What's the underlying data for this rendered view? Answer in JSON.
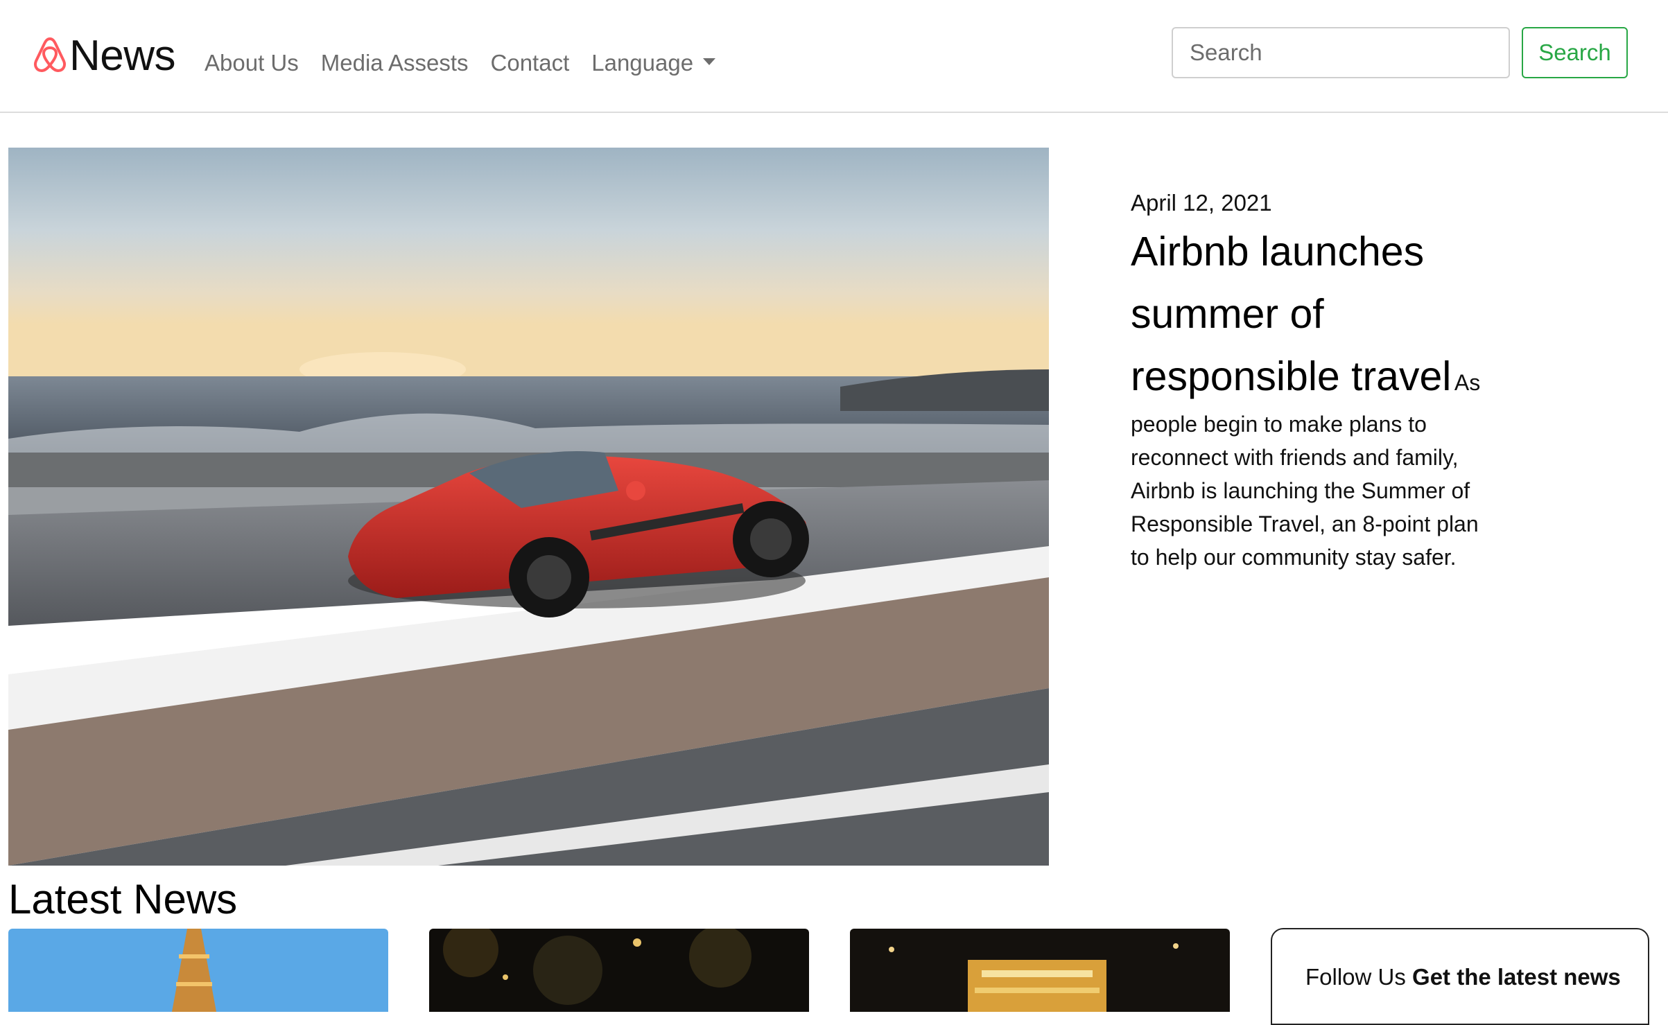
{
  "brand": {
    "name": "News",
    "logo_icon": "airbnb-logo-icon"
  },
  "nav": {
    "links": [
      "About Us",
      "Media Assests",
      "Contact",
      "Language"
    ]
  },
  "search": {
    "placeholder": "Search",
    "button_label": "Search"
  },
  "hero": {
    "date": "April 12, 2021",
    "title": "Airbnb launches summer of responsible travel",
    "description": "As people begin to make plans to reconnect with friends and family, Airbnb is launching the Summer of Responsible Travel, an 8-point plan to help our community stay safer."
  },
  "latest": {
    "heading": "Latest News"
  },
  "follow": {
    "label": "Follow Us",
    "tagline": "Get the latest news"
  },
  "colors": {
    "brand_accent": "#ff5a5f",
    "success": "#28a745",
    "nav_text": "#6c6c6c"
  }
}
